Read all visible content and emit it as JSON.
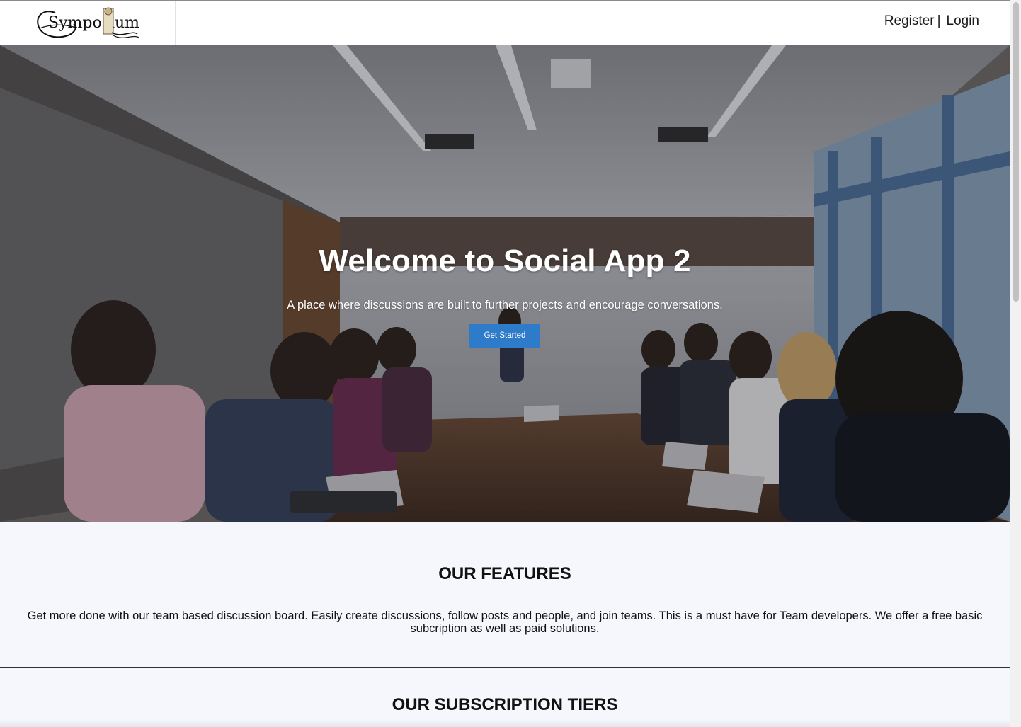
{
  "header": {
    "logo_text": "Symposium",
    "register_label": "Register",
    "separator": "|",
    "login_label": "Login"
  },
  "hero": {
    "title": "Welcome to Social App 2",
    "subtitle": "A place where discussions are built to further projects and encourage conversations.",
    "cta_label": "Get Started"
  },
  "features": {
    "heading": "OUR FEATURES",
    "description": "Get more done with our team based discussion board. Easily create discussions, follow posts and people, and join teams. This is a must have for Team developers. We offer a free basic subcription as well as paid solutions."
  },
  "tiers": {
    "heading": "OUR SUBSCRIPTION TIERS"
  },
  "colors": {
    "accent": "#2e7bc9",
    "section_bg": "#f5f7fc"
  }
}
